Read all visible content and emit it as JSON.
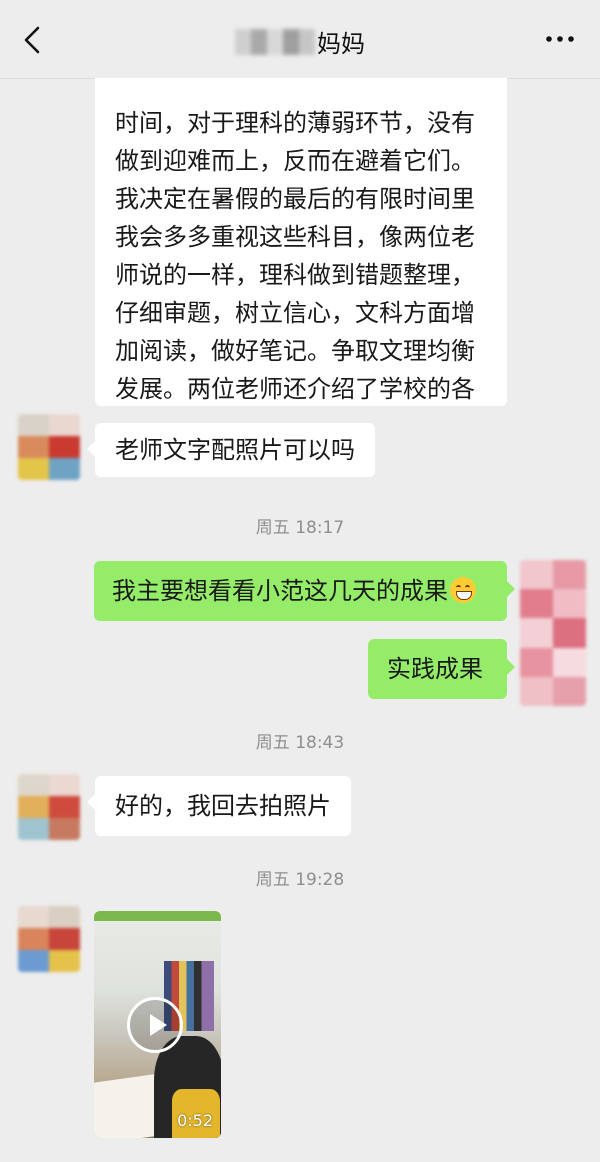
{
  "header": {
    "title": "妈妈",
    "back_icon": "chevron-left-icon",
    "more_icon": "ellipsis-icon"
  },
  "messages": {
    "long_text": "时间，对于理科的薄弱环节，没有\n做到迎难而上，反而在避着它们。\n我决定在暑假的最后的有限时间里\n我会多多重视这些科目，像两位老\n师说的一样，理科做到错题整理，\n仔细审题，树立信心，文科方面增\n加阅读，做好笔记。争取文理均衡\n发展。两位老师还介绍了学校的各\n种社团课，让我心里有了小小的期\n待。",
    "msg_photo_question": "老师文字配照片可以吗",
    "time1": "周五 18:17",
    "msg_want_results": "我主要想看看小范这几天的成果",
    "msg_want_results_emoji": "grinning-face-emoji",
    "msg_practice": "实践成果",
    "time2": "周五 18:43",
    "msg_ok": "好的，我回去拍照片",
    "time3": "周五 19:28",
    "video": {
      "duration": "0:52",
      "play_icon": "play-icon"
    }
  },
  "colors": {
    "background": "#ededed",
    "incoming_bubble": "#ffffff",
    "outgoing_bubble": "#95ec69",
    "timestamp": "#8e8e8e"
  }
}
